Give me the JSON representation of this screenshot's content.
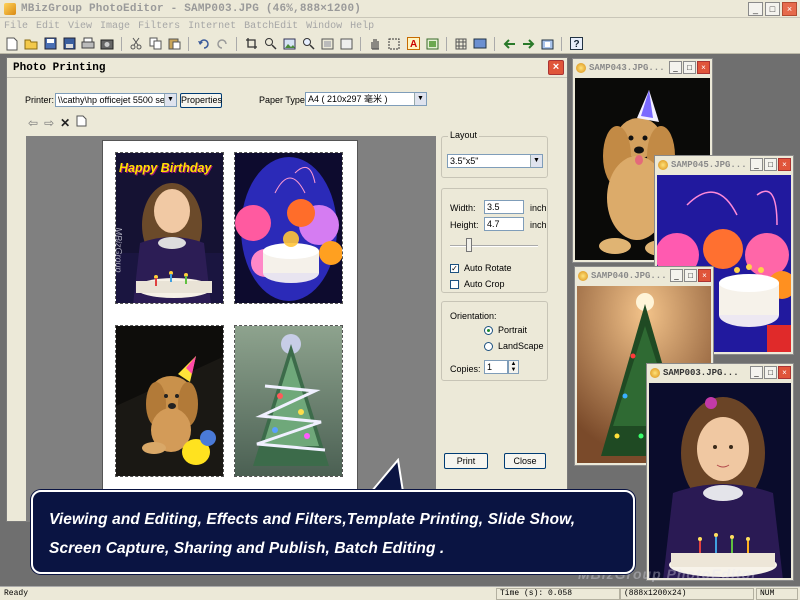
{
  "app": {
    "title": "MBizGroup PhotoEditor - SAMP003.JPG (46%,888×1200)",
    "window_buttons": [
      "_",
      "□",
      "×"
    ],
    "menu": [
      "File",
      "Edit",
      "View",
      "Image",
      "Filters",
      "Internet",
      "BatchEdit",
      "Window",
      "Help"
    ]
  },
  "toolbar": {
    "icons": [
      "new-icon",
      "open-icon",
      "save-icon",
      "save-as-icon",
      "print-icon",
      "scan-icon",
      "cut-icon",
      "copy-icon",
      "paste-icon",
      "undo-icon",
      "redo-icon",
      "crop-icon",
      "resize-icon",
      "canvas-icon",
      "zoom-icon",
      "fit-icon",
      "actual-size-icon",
      "hand-icon",
      "select-icon",
      "text-icon",
      "frame-icon",
      "grid-icon",
      "slideshow-icon",
      "prev-icon",
      "next-icon",
      "capture-icon",
      "help-icon"
    ]
  },
  "dialog": {
    "title": "Photo Printing",
    "printer_label": "Printer:",
    "printer_value": "\\\\cathy\\hp officejet 5500 series",
    "properties_label": "Properties",
    "paper_label": "Paper Type:",
    "paper_value": "A4 ( 210x297 毫米 )",
    "layout_label": "Layout",
    "layout_value": "3.5\"x5\"",
    "width_label": "Width:",
    "width_value": "3.5",
    "height_label": "Height:",
    "height_value": "4.7",
    "unit": "inch",
    "auto_rotate_label": "Auto Rotate",
    "auto_rotate_checked": true,
    "auto_crop_label": "Auto Crop",
    "auto_crop_checked": false,
    "orientation_label": "Orientation:",
    "portrait_label": "Portrait",
    "landscape_label": "LandScape",
    "copies_label": "Copies:",
    "copies_value": "1",
    "print_label": "Print",
    "close_label": "Close",
    "thumb1_text": "Happy Birthday",
    "thumb1_watermark": "MBizGroup"
  },
  "windows": [
    {
      "title": "SAMP043.JPG..."
    },
    {
      "title": "SAMP045.JPG..."
    },
    {
      "title": "SAMP040.JPG..."
    },
    {
      "title": "SAMP003.JPG..."
    }
  ],
  "callout": {
    "line1": "Viewing and Editing, Effects and Filters,Template Printing, Slide Show,",
    "line2": "Screen Capture, Sharing and Publish, Batch Editing ."
  },
  "watermark": "MBizGroup PhotoEditor",
  "status": {
    "left": "Ready",
    "time": "Time (s): 0.058",
    "size": "(888x1200x24)",
    "num": "NUM"
  },
  "colors": {
    "callout_bg": "#0a1442",
    "window_chrome": "#ece9d8",
    "close_red": "#e0553a"
  }
}
